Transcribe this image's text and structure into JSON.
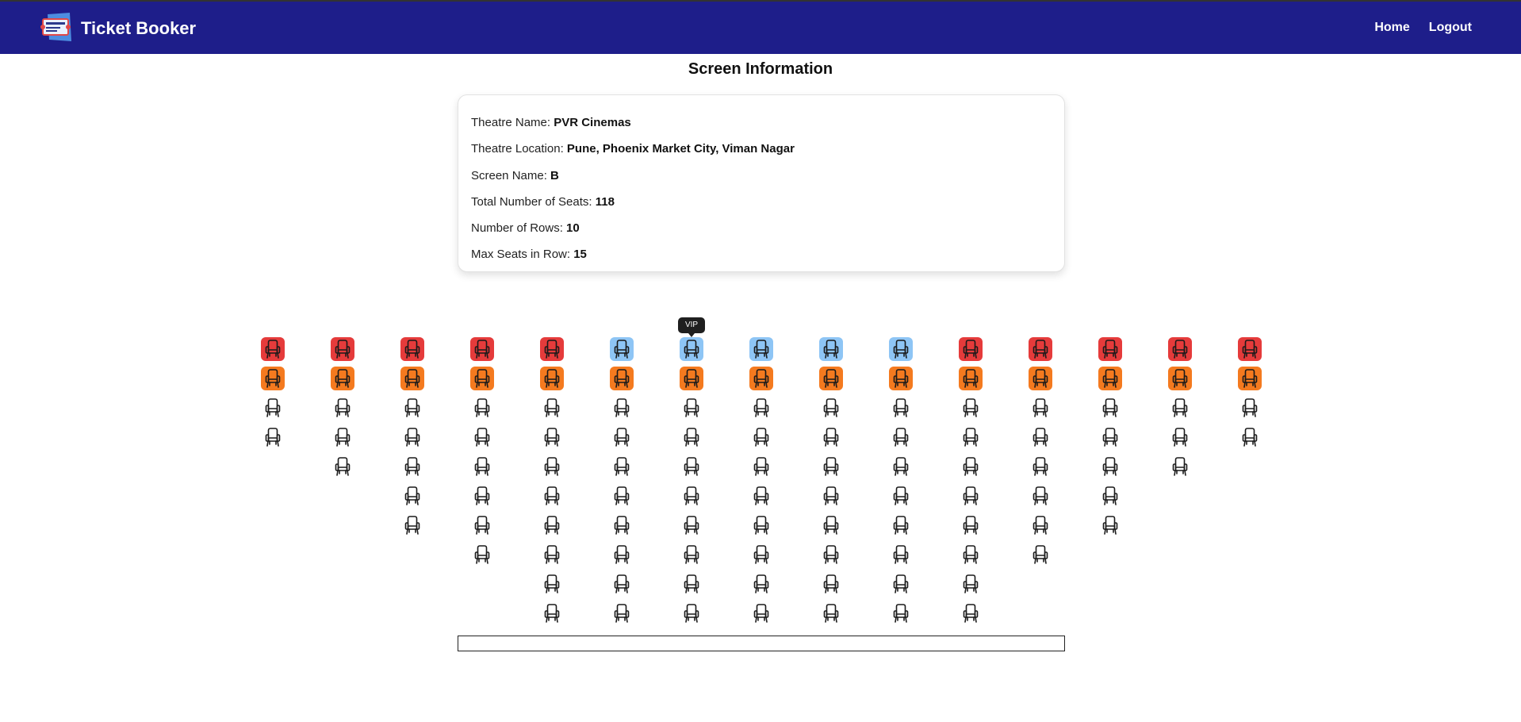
{
  "app": {
    "title": "Ticket Booker",
    "logo_icon": "ticket-icon"
  },
  "nav": {
    "items": [
      {
        "label": "Home"
      },
      {
        "label": "Logout"
      }
    ]
  },
  "page": {
    "title": "Screen Information"
  },
  "info": {
    "theatre_name_label": "Theatre Name:",
    "theatre_name": "PVR Cinemas",
    "theatre_location_label": "Theatre Location:",
    "theatre_location": "Pune, Phoenix Market City, Viman Nagar",
    "screen_name_label": "Screen Name:",
    "screen_name": "B",
    "total_seats_label": "Total Number of Seats:",
    "total_seats": "118",
    "rows_label": "Number of Rows:",
    "rows": "10",
    "max_seats_label": "Max Seats in Row:",
    "max_seats": "15"
  },
  "seat_map": {
    "seat_icon": "seat-icon",
    "tooltip": "VIP",
    "column_heights": [
      4,
      5,
      7,
      8,
      10,
      10,
      10,
      10,
      10,
      10,
      10,
      8,
      7,
      5,
      4
    ],
    "row1_types": [
      "red",
      "red",
      "red",
      "red",
      "red",
      "vip",
      "vip",
      "vip",
      "vip",
      "vip",
      "red",
      "red",
      "red",
      "red",
      "red"
    ],
    "row2_type": "orange",
    "colors": {
      "red": "#e53b3b",
      "vip": "#8ec5f5",
      "orange": "#f47a1f",
      "standard": "#ffffff"
    }
  },
  "screen": {
    "label": ""
  }
}
